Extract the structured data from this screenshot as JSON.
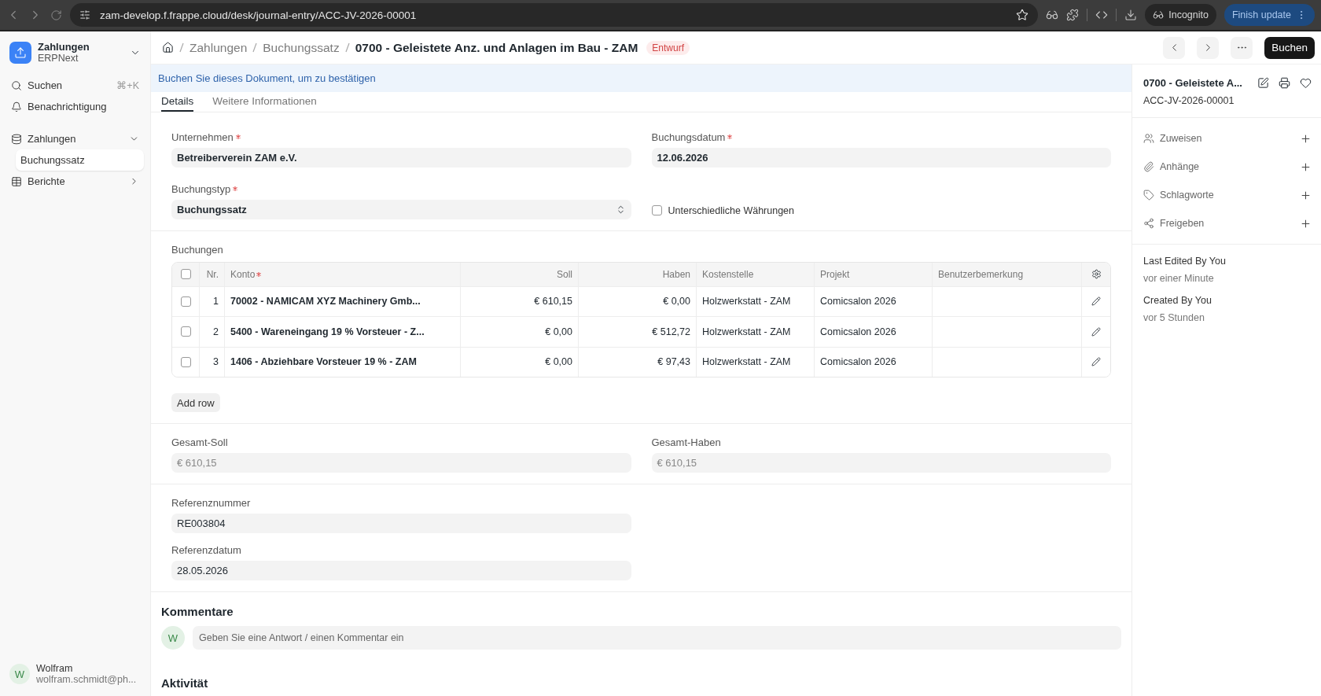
{
  "browser": {
    "url": "zam-develop.f.frappe.cloud/desk/journal-entry/ACC-JV-2026-00001",
    "incognito_label": "Incognito",
    "update_button": "Finish update"
  },
  "sidebar": {
    "app": {
      "title": "Zahlungen",
      "subtitle": "ERPNext"
    },
    "items": [
      {
        "kind": "search",
        "label": "Suchen",
        "shortcut": "⌘+K"
      },
      {
        "kind": "bell",
        "label": "Benachrichtigung"
      }
    ],
    "sections": [
      {
        "kind": "workspace",
        "label": "Zahlungen",
        "expanded": true,
        "children": [
          {
            "label": "Buchungssatz",
            "selected": true
          }
        ]
      },
      {
        "kind": "reports",
        "label": "Berichte",
        "expanded": false
      }
    ],
    "user": {
      "initial": "W",
      "name": "Wolfram",
      "email": "wolfram.schmidt@ph..."
    }
  },
  "header": {
    "breadcrumbs": [
      "Zahlungen",
      "Buchungssatz"
    ],
    "title": "0700 - Geleistete Anz. und Anlagen im Bau - ZAM",
    "status": "Entwurf",
    "primary_button": "Buchen"
  },
  "banner": "Buchen Sie dieses Dokument, um zu bestätigen",
  "tabs": [
    {
      "label": "Details",
      "selected": true
    },
    {
      "label": "Weitere Informationen",
      "selected": false
    }
  ],
  "fields_top": [
    {
      "kind": "input",
      "label": "Unternehmen",
      "required": true,
      "value": "Betreiberverein ZAM e.V."
    },
    {
      "kind": "input",
      "label": "Buchungsdatum",
      "required": true,
      "value": "12.06.2026"
    },
    {
      "kind": "select",
      "label": "Buchungstyp",
      "required": true,
      "value": "Buchungssatz"
    },
    {
      "kind": "checkbox",
      "label": "Unterschiedliche Währungen",
      "checked": false
    }
  ],
  "table": {
    "title": "Buchungen",
    "all_checked": false,
    "columns": [
      {
        "label": "Nr.",
        "kind": "numeric",
        "required": false
      },
      {
        "label": "Konto",
        "kind": "text",
        "required": true
      },
      {
        "label": "Soll",
        "kind": "numeric",
        "required": false
      },
      {
        "label": "Haben",
        "kind": "numeric",
        "required": false
      },
      {
        "label": "Kostenstelle",
        "kind": "text",
        "required": false
      },
      {
        "label": "Projekt",
        "kind": "text",
        "required": false
      },
      {
        "label": "Benutzerbemerkung",
        "kind": "text",
        "required": false
      }
    ],
    "rows": [
      {
        "checked": false,
        "cells": [
          "1",
          "70002 - NAMICAM XYZ Machinery Gmb...",
          "€ 610,15",
          "€ 0,00",
          "Holzwerkstatt - ZAM",
          "Comicsalon 2026",
          ""
        ]
      },
      {
        "checked": false,
        "cells": [
          "2",
          "5400 - Wareneingang 19 % Vorsteuer - Z...",
          "€ 0,00",
          "€ 512,72",
          "Holzwerkstatt - ZAM",
          "Comicsalon 2026",
          ""
        ]
      },
      {
        "checked": false,
        "cells": [
          "3",
          "1406 - Abziehbare Vorsteuer 19 % - ZAM",
          "€ 0,00",
          "€ 97,43",
          "Holzwerkstatt - ZAM",
          "Comicsalon 2026",
          ""
        ]
      }
    ],
    "add_button": "Add row"
  },
  "totals": [
    {
      "label": "Gesamt-Soll",
      "value": "€ 610,15"
    },
    {
      "label": "Gesamt-Haben",
      "value": "€ 610,15"
    }
  ],
  "references": [
    {
      "label": "Referenznummer",
      "value": "RE003804"
    },
    {
      "label": "Referenzdatum",
      "value": "28.05.2026"
    }
  ],
  "comments": {
    "title": "Kommentare",
    "initial": "W",
    "placeholder": "Geben Sie eine Antwort / einen Kommentar ein"
  },
  "activity": {
    "title": "Aktivität"
  },
  "side_panel": {
    "title": "0700 - Geleistete A...",
    "name": "ACC-JV-2026-00001",
    "actions": [
      {
        "kind": "assign",
        "label": "Zuweisen"
      },
      {
        "kind": "attach",
        "label": "Anhänge"
      },
      {
        "kind": "tag",
        "label": "Schlagworte"
      },
      {
        "kind": "share",
        "label": "Freigeben"
      }
    ],
    "meta": [
      {
        "label": "Last Edited By You",
        "time": "vor einer Minute"
      },
      {
        "label": "Created By You",
        "time": "vor 5 Stunden"
      }
    ]
  }
}
